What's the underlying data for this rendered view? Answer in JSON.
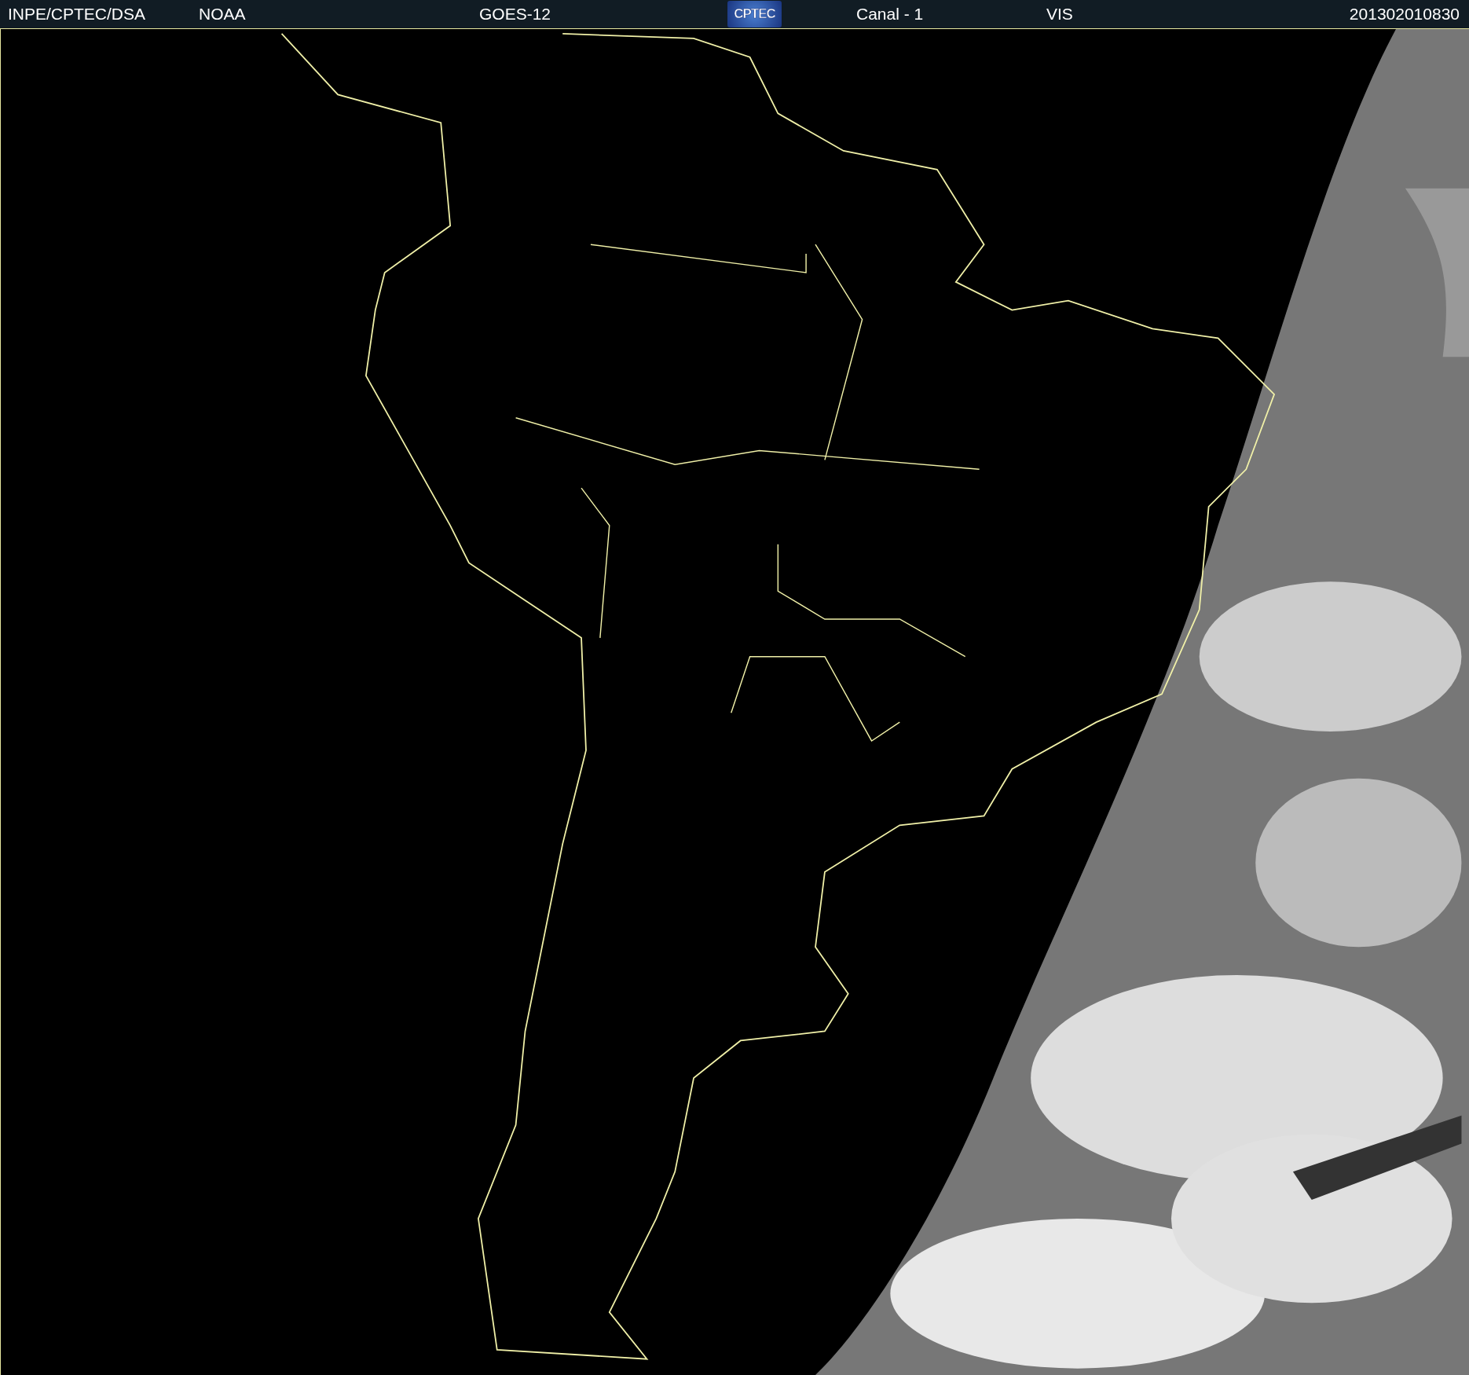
{
  "header": {
    "items": [
      {
        "kind": "text",
        "text": "INPE/CPTEC/DSA"
      },
      {
        "kind": "text",
        "text": "NOAA"
      },
      {
        "kind": "text",
        "text": "GOES-12"
      },
      {
        "kind": "logo",
        "text": "CPTEC"
      },
      {
        "kind": "text",
        "text": "Canal - 1"
      },
      {
        "kind": "text",
        "text": "VIS"
      },
      {
        "kind": "text",
        "text": "201302010830"
      }
    ]
  }
}
